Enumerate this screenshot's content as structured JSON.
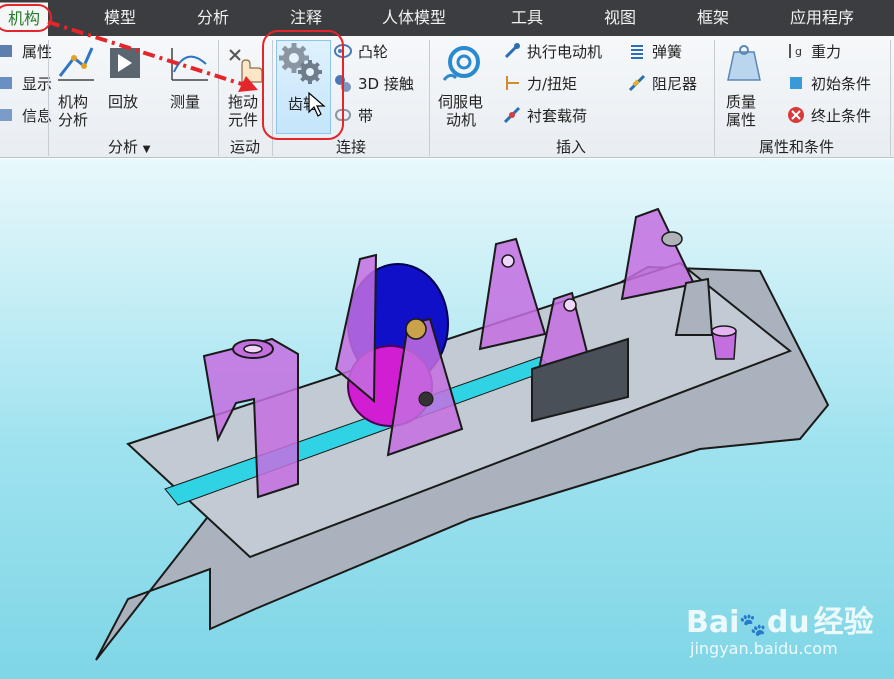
{
  "tabs": {
    "active": "机构",
    "model": "模型",
    "analysis": "分析",
    "annotation": "注释",
    "manikin": "人体模型",
    "tools": "工具",
    "view": "视图",
    "framework": "框架",
    "applications": "应用程序"
  },
  "ribbon": {
    "left_cut": {
      "properties": "属性",
      "display": "显示",
      "info": "信息"
    },
    "analysis_group": {
      "mech_analysis": [
        "机构",
        "分析"
      ],
      "playback": "回放",
      "measure": "测量",
      "label": "分析"
    },
    "motion_group": {
      "drag": [
        "拖动",
        "元件"
      ],
      "label": "运动"
    },
    "connect_group": {
      "gears": "齿轮",
      "cam": "凸轮",
      "contact_3d": "3D 接触",
      "belt": "带",
      "label": "连接"
    },
    "insert_group": {
      "servo_motor": [
        "伺服电",
        "动机"
      ],
      "force_motor": "执行电动机",
      "force_torque": "力/扭矩",
      "bushing_load": "衬套载荷",
      "spring": "弹簧",
      "damper": "阻尼器",
      "label": "插入"
    },
    "props_group": {
      "mass_props": [
        "质量",
        "属性"
      ],
      "gravity": "重力",
      "initial_conditions": "初始条件",
      "termination_conditions": "终止条件",
      "label": "属性和条件"
    }
  },
  "watermark": {
    "brand_letters": "Bai",
    "brand_tail": "du",
    "brand_cn": "经验",
    "url": "jingyan.baidu.com"
  },
  "colors": {
    "tabbar": "#3b3d40",
    "highlight_red": "#e4262a",
    "model_purple": "#c46fe0",
    "gear_blue": "#1010c8",
    "gear_magenta": "#d21ed2",
    "rail_cyan": "#2fd3e3",
    "base_gray": "#aab3bd"
  }
}
